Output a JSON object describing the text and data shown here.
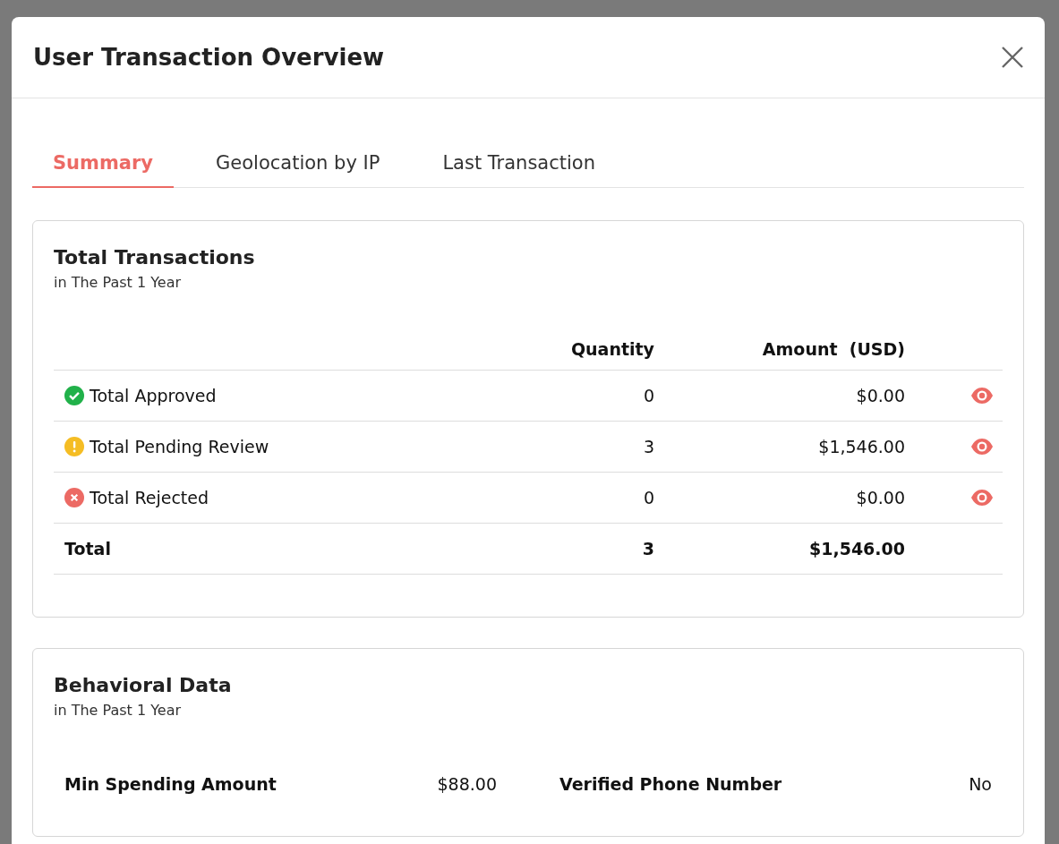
{
  "modal": {
    "title": "User Transaction Overview"
  },
  "tabs": [
    {
      "label": "Summary",
      "selected": true
    },
    {
      "label": "Geolocation by IP",
      "selected": false
    },
    {
      "label": "Last Transaction",
      "selected": false
    }
  ],
  "transactions": {
    "title": "Total Transactions",
    "subtitle": "in The Past 1 Year",
    "columns": [
      "Quantity",
      "Amount  (USD)"
    ],
    "rows": [
      {
        "kind": "approved",
        "color": "#21b14a",
        "label": "Total Approved",
        "quantity": "0",
        "amount": "$0.00"
      },
      {
        "kind": "pending",
        "color": "#f5bd24",
        "label": "Total Pending Review",
        "quantity": "3",
        "amount": "$1,546.00"
      },
      {
        "kind": "rejected",
        "color": "#ec6a64",
        "label": "Total Rejected",
        "quantity": "0",
        "amount": "$0.00"
      },
      {
        "kind": "total",
        "label": "Total",
        "quantity": "3",
        "amount": "$1,546.00"
      }
    ]
  },
  "behavioral": {
    "title": "Behavioral Data",
    "subtitle": "in The Past 1 Year",
    "items": [
      {
        "label": "Min Spending Amount",
        "value": "$88.00"
      },
      {
        "label": "Verified Phone Number",
        "value": "No"
      }
    ]
  }
}
